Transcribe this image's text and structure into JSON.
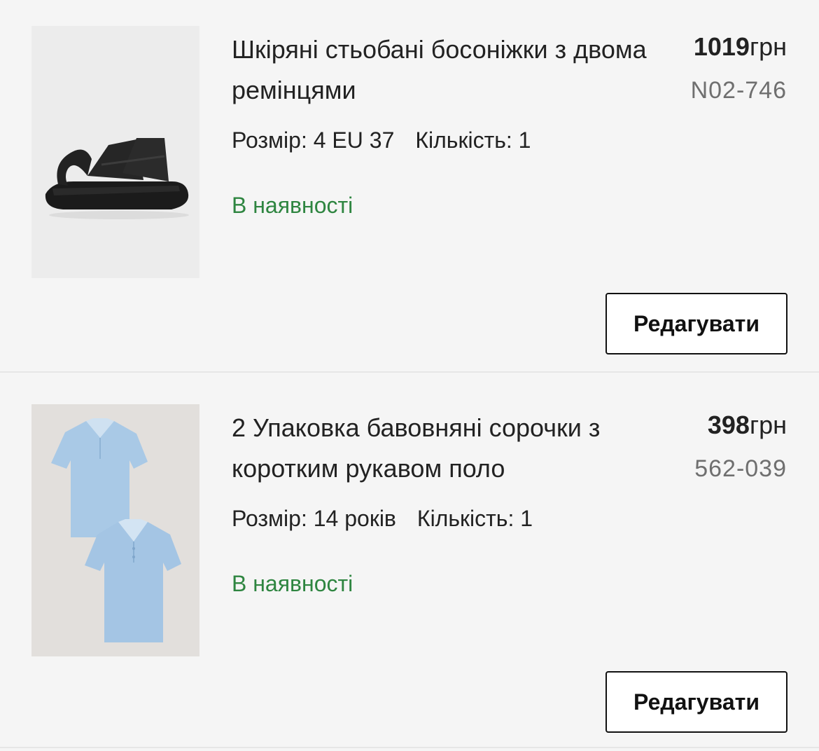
{
  "colors": {
    "background": "#f5f5f5",
    "text": "#222222",
    "sku": "#6f6f6f",
    "in_stock": "#2e8540",
    "button_border": "#111111",
    "divider": "#e6e6e6"
  },
  "items": [
    {
      "title": "Шкіряні стьобані босоніжки з двома ремінцями",
      "price_amount": "1019",
      "price_currency": "грн",
      "sku": "N02-746",
      "size_text": "Розмір: 4 EU 37",
      "quantity_text": "Кількість: 1",
      "stock_status": "В наявності",
      "edit_label": "Редагувати",
      "image_icon": "black-sandal-photo"
    },
    {
      "title": "2 Упаковка бавовняні сорочки з коротким рукавом поло",
      "price_amount": "398",
      "price_currency": "грн",
      "sku": "562-039",
      "size_text": "Розмір: 14 років",
      "quantity_text": "Кількість: 1",
      "stock_status": "В наявності",
      "edit_label": "Редагувати",
      "image_icon": "blue-polo-shirts-photo"
    }
  ]
}
